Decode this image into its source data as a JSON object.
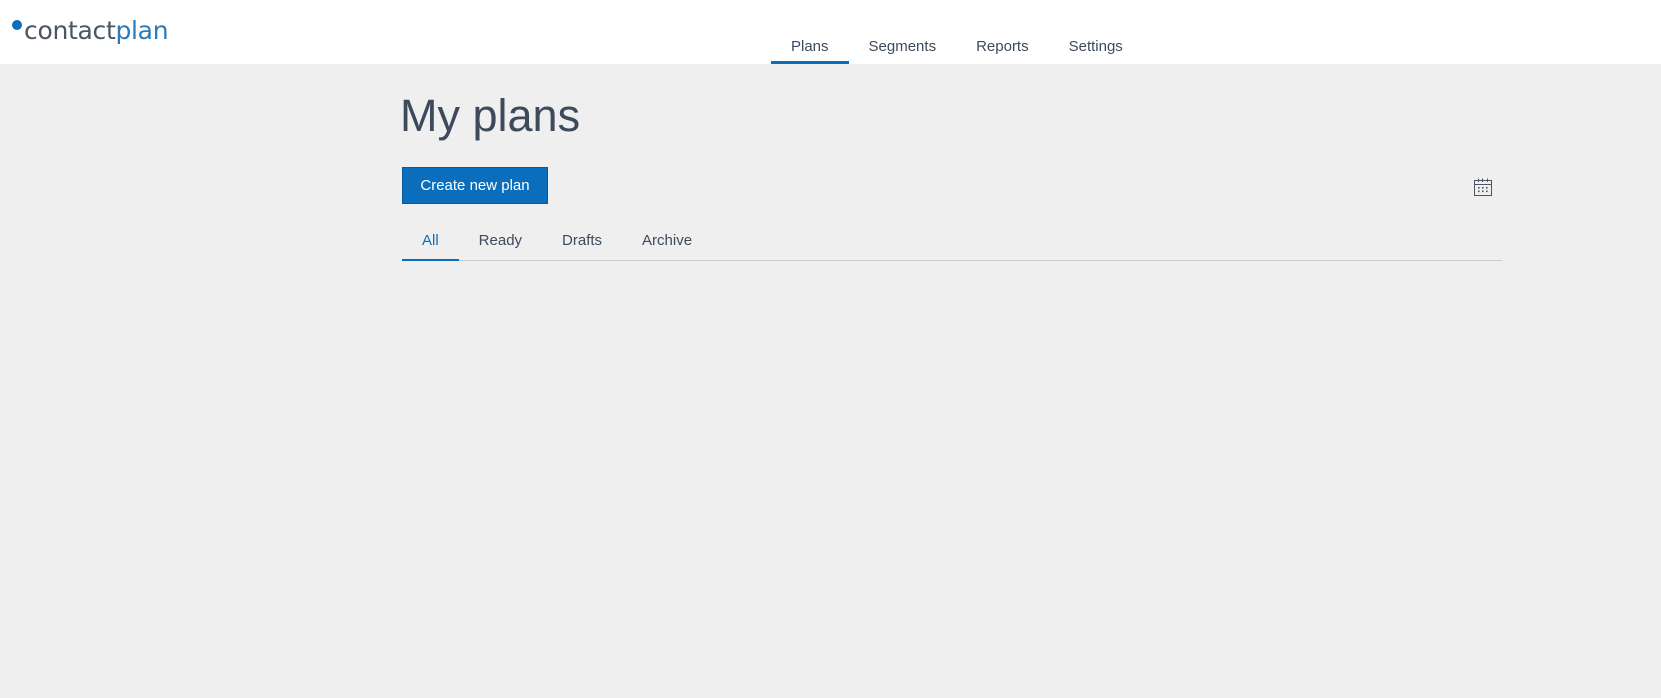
{
  "brand": {
    "logo_part1": "contact",
    "logo_part2": "plan",
    "accent": "#0a6ebd"
  },
  "nav": {
    "items": [
      {
        "label": "Plans",
        "active": true
      },
      {
        "label": "Segments",
        "active": false
      },
      {
        "label": "Reports",
        "active": false
      },
      {
        "label": "Settings",
        "active": false
      }
    ]
  },
  "page": {
    "title": "My plans"
  },
  "toolbar": {
    "create_label": "Create new plan",
    "calendar_icon": "calendar-icon"
  },
  "filters": {
    "tabs": [
      {
        "label": "All",
        "active": true
      },
      {
        "label": "Ready",
        "active": false
      },
      {
        "label": "Drafts",
        "active": false
      },
      {
        "label": "Archive",
        "active": false
      }
    ]
  }
}
